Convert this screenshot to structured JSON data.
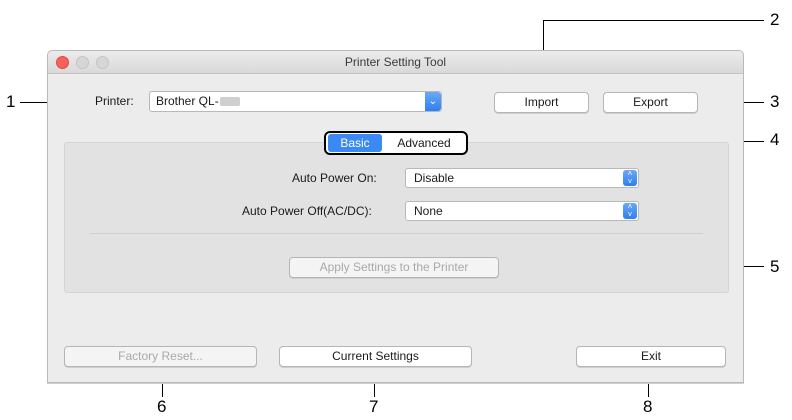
{
  "window": {
    "title": "Printer Setting Tool"
  },
  "printer": {
    "label": "Printer:",
    "value": "Brother QL-"
  },
  "toolbar": {
    "import_label": "Import",
    "export_label": "Export"
  },
  "tabs": [
    {
      "label": "Basic",
      "active": true
    },
    {
      "label": "Advanced",
      "active": false
    }
  ],
  "settings": {
    "auto_power_on_label": "Auto Power On:",
    "auto_power_on_value": "Disable",
    "auto_power_off_label": "Auto Power Off(AC/DC):",
    "auto_power_off_value": "None",
    "apply_label": "Apply Settings to the Printer"
  },
  "footer": {
    "factory_reset_label": "Factory Reset...",
    "current_settings_label": "Current Settings",
    "exit_label": "Exit"
  },
  "callouts": [
    "1",
    "2",
    "3",
    "4",
    "5",
    "6",
    "7",
    "8"
  ],
  "colors": {
    "accent": "#3a89f5",
    "close": "#fc605b"
  }
}
